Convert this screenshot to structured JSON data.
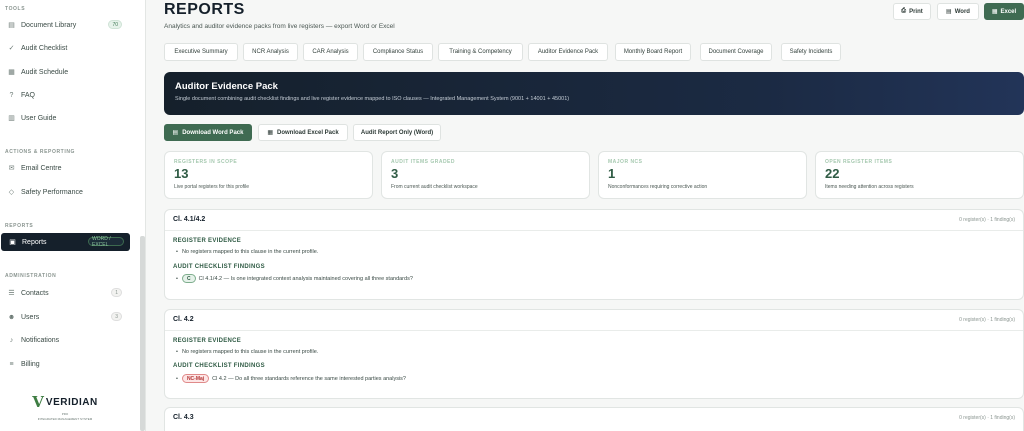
{
  "sidebar": {
    "sections": {
      "tools": "TOOLS",
      "actions": "ACTIONS & REPORTING",
      "reports": "REPORTS",
      "administration": "ADMINISTRATION"
    },
    "items": [
      {
        "label": "Document Library",
        "badge": "70",
        "icon": "folder-icon"
      },
      {
        "label": "Audit Checklist",
        "icon": "check-icon"
      },
      {
        "label": "Audit Schedule",
        "icon": "calendar-icon"
      },
      {
        "label": "FAQ",
        "icon": "question-icon"
      },
      {
        "label": "User Guide",
        "icon": "book-icon"
      },
      {
        "label": "Email Centre",
        "icon": "mail-icon"
      },
      {
        "label": "Safety Performance",
        "icon": "shield-icon"
      },
      {
        "label": "Reports",
        "badge": "WORD / EXCEL",
        "icon": "report-icon"
      },
      {
        "label": "Contacts",
        "badge": "1",
        "icon": "contacts-icon"
      },
      {
        "label": "Users",
        "badge": "3",
        "icon": "users-icon"
      },
      {
        "label": "Notifications",
        "icon": "bell-icon"
      },
      {
        "label": "Billing",
        "icon": "billing-icon"
      }
    ],
    "logo": {
      "name": "VERIDIAN",
      "sub": "PRO",
      "tagline": "INTEGRATED MANAGEMENT SYSTEM"
    }
  },
  "header": {
    "title": "REPORTS",
    "subtitle": "Analytics and auditor evidence packs from live registers — export Word or Excel",
    "buttons": {
      "print": "Print",
      "word": "Word",
      "excel": "Excel"
    }
  },
  "tabs": [
    "Executive Summary",
    "NCR Analysis",
    "CAR Analysis",
    "Compliance Status",
    "Training & Competency",
    "Auditor Evidence Pack",
    "Monthly Board Report",
    "Document Coverage",
    "Safety Incidents"
  ],
  "banner": {
    "title": "Auditor Evidence Pack",
    "subtitle": "Single document combining audit checklist findings and live register evidence mapped to ISO clauses — Integrated Management System (9001 + 14001 + 45001)"
  },
  "actions": {
    "word_pack": "Download Word Pack",
    "excel_pack": "Download Excel Pack",
    "audit_report": "Audit Report Only (Word)"
  },
  "stats": [
    {
      "label": "REGISTERS IN SCOPE",
      "value": "13",
      "desc": "Live portal registers for this profile"
    },
    {
      "label": "AUDIT ITEMS GRADED",
      "value": "3",
      "desc": "From current audit checklist workspace"
    },
    {
      "label": "MAJOR NCS",
      "value": "1",
      "desc": "Nonconformances requiring corrective action"
    },
    {
      "label": "OPEN REGISTER ITEMS",
      "value": "22",
      "desc": "Items needing attention across registers"
    }
  ],
  "clauses": [
    {
      "title": "Cl. 4.1/4.2",
      "meta": "0 register(s) · 1 finding(s)",
      "register_heading": "REGISTER EVIDENCE",
      "register_text": "No registers mapped to this clause in the current profile.",
      "findings_heading": "AUDIT CHECKLIST FINDINGS",
      "finding_badge": "C",
      "finding_text": "Cl 4.1/4.2 — Is one integrated context analysis maintained covering all three standards?"
    },
    {
      "title": "Cl. 4.2",
      "meta": "0 register(s) · 1 finding(s)",
      "register_heading": "REGISTER EVIDENCE",
      "register_text": "No registers mapped to this clause in the current profile.",
      "findings_heading": "AUDIT CHECKLIST FINDINGS",
      "finding_badge": "NC-Maj",
      "finding_text": "Cl 4.2 — Do all three standards reference the same interested parties analysis?"
    },
    {
      "title": "Cl. 4.3",
      "meta": "0 register(s) · 1 finding(s)"
    }
  ],
  "colors": {
    "accent": "#3f6b52",
    "dark": "#15202b",
    "nc": "#b23333"
  }
}
